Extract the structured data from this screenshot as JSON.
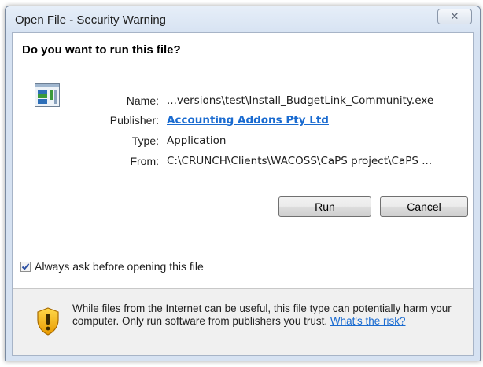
{
  "window": {
    "title": "Open File - Security Warning",
    "close_glyph": "✕"
  },
  "question": "Do you want to run this file?",
  "file_icon": "application-window-icon",
  "fields": {
    "name": {
      "label": "Name:",
      "value": "...versions\\test\\Install_BudgetLink_Community.exe"
    },
    "publisher": {
      "label": "Publisher:",
      "value": "Accounting Addons Pty Ltd"
    },
    "type": {
      "label": "Type:",
      "value": "Application"
    },
    "from": {
      "label": "From:",
      "value": "C:\\CRUNCH\\Clients\\WACOSS\\CaPS project\\CaPS ..."
    }
  },
  "buttons": {
    "run": "Run",
    "cancel": "Cancel"
  },
  "checkbox": {
    "label": "Always ask before opening this file",
    "checked": true
  },
  "warning": {
    "icon": "security-shield-icon",
    "text": "While files from the Internet can be useful, this file type can potentially harm your computer. Only run software from publishers you trust.",
    "link": "What's the risk?"
  },
  "colors": {
    "link": "#1a6bd0",
    "shield": "#f2b705"
  }
}
